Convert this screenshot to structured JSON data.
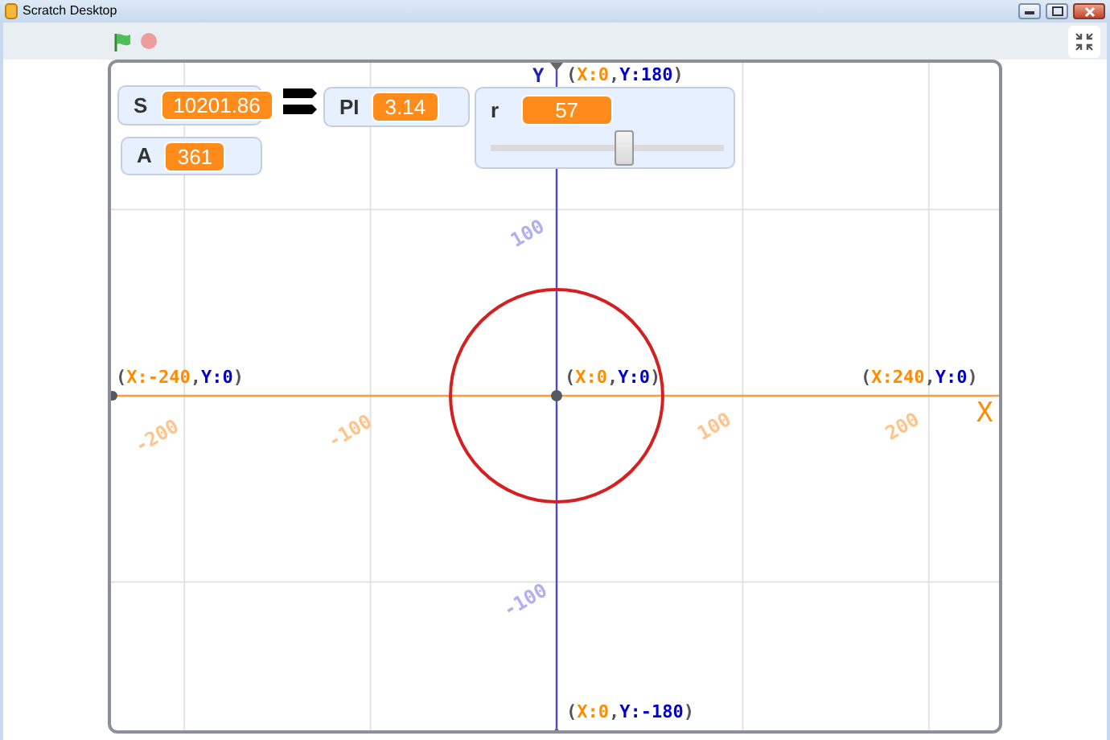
{
  "window": {
    "title": "Scratch Desktop"
  },
  "monitors": [
    {
      "kind": "readout",
      "label": "S",
      "value": "10201.86"
    },
    {
      "kind": "readout",
      "label": "PI",
      "value": "3.14"
    },
    {
      "kind": "slider",
      "label": "r",
      "value": "57",
      "level": 0.57
    },
    {
      "kind": "readout",
      "label": "A",
      "value": "361"
    }
  ],
  "axes": {
    "x_name": "X",
    "y_name": "Y"
  },
  "coordinate_labels": [
    {
      "parts": [
        {
          "text": "(",
          "kind": "paren"
        },
        {
          "text": "X:0",
          "kind": "x"
        },
        {
          "text": ",",
          "kind": "paren"
        },
        {
          "text": "Y:180",
          "kind": "y"
        },
        {
          "text": ")",
          "kind": "paren"
        }
      ]
    },
    {
      "parts": [
        {
          "text": "(",
          "kind": "paren"
        },
        {
          "text": "X:-240",
          "kind": "x"
        },
        {
          "text": ",",
          "kind": "paren"
        },
        {
          "text": "Y:0",
          "kind": "y"
        },
        {
          "text": ")",
          "kind": "paren"
        }
      ]
    },
    {
      "parts": [
        {
          "text": "(",
          "kind": "paren"
        },
        {
          "text": "X:0",
          "kind": "x"
        },
        {
          "text": ",",
          "kind": "paren"
        },
        {
          "text": "Y:0",
          "kind": "y"
        },
        {
          "text": ")",
          "kind": "paren"
        }
      ]
    },
    {
      "parts": [
        {
          "text": "(",
          "kind": "paren"
        },
        {
          "text": "X:240",
          "kind": "x"
        },
        {
          "text": ",",
          "kind": "paren"
        },
        {
          "text": "Y:0",
          "kind": "y"
        },
        {
          "text": ")",
          "kind": "paren"
        }
      ]
    },
    {
      "parts": [
        {
          "text": "(",
          "kind": "paren"
        },
        {
          "text": "X:0",
          "kind": "x"
        },
        {
          "text": ",",
          "kind": "paren"
        },
        {
          "text": "Y:-180",
          "kind": "y"
        },
        {
          "text": ")",
          "kind": "paren"
        }
      ]
    }
  ],
  "x_ticks": [
    "-200",
    "-100",
    "100",
    "200"
  ],
  "y_ticks": [
    "100",
    "-100"
  ]
}
